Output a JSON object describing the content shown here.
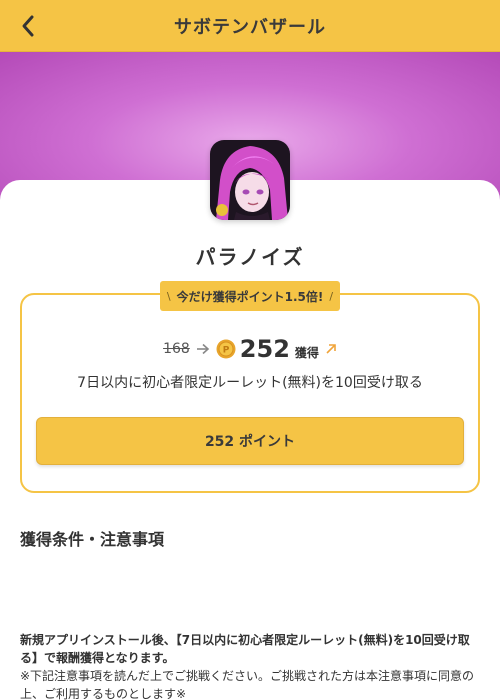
{
  "header": {
    "title": "サボテンバザール",
    "back_icon": "chevron-left-icon"
  },
  "colors": {
    "accent": "#f5c445",
    "hero_gradient": [
      "#e9a9ea",
      "#cf6fd3",
      "#b44ab8"
    ]
  },
  "app": {
    "name": "パラノイズ",
    "icon": "anime-character-app-icon"
  },
  "promo": {
    "slash_left": "\\",
    "label": "今だけ獲得ポイント1.5倍!",
    "slash_right": "/"
  },
  "reward": {
    "old_points": "168",
    "new_points": "252",
    "earn_label": "獲得",
    "condition": "7日以内に初心者限定ルーレット(無料)を10回受け取る",
    "button_label": "252 ポイント"
  },
  "notes": {
    "section_title": "獲得条件・注意事項",
    "bold_text": "新規アプリインストール後、【7日以内に初心者限定ルーレット(無料)を10回受け取る】で報酬獲得となります。",
    "plain_text": "※下記注意事項を読んだ上でご挑戦ください。ご挑戦された方は本注意事項に同意の上、ご利用するものとします※"
  }
}
